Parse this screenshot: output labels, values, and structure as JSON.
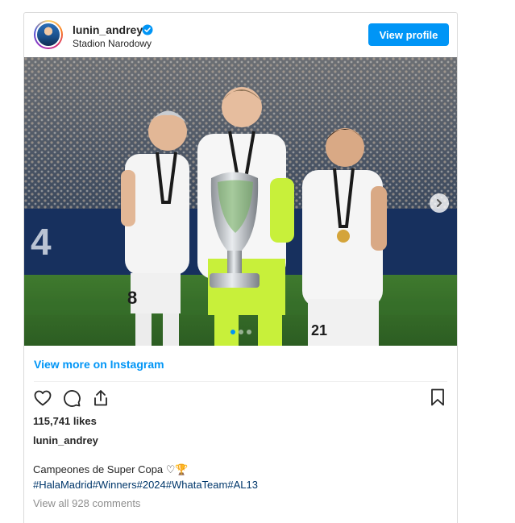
{
  "header": {
    "username": "lunin_andrey",
    "location": "Stadion Narodowy",
    "view_profile_label": "View profile"
  },
  "photo": {
    "description_alt": "Three Real Madrid players holding the Super Cup trophy",
    "carousel": {
      "count": 3,
      "active_index": 0
    }
  },
  "links": {
    "view_more": "View more on Instagram"
  },
  "actions": {
    "icons": [
      "heart-icon",
      "comment-icon",
      "share-icon",
      "bookmark-icon"
    ]
  },
  "post": {
    "likes": "115,741 likes",
    "caption_user": "lunin_andrey",
    "caption_text": "Campeones de Super Copa ♡🏆",
    "hashtags": "#HalaMadrid#Winners#2024#WhataTeam#AL13",
    "comments_link": "View all 928 comments"
  },
  "colors": {
    "accent": "#0095f6",
    "hashtag": "#00376b",
    "muted": "#8e8e8e",
    "keeper_kit": "#c8f03a"
  }
}
